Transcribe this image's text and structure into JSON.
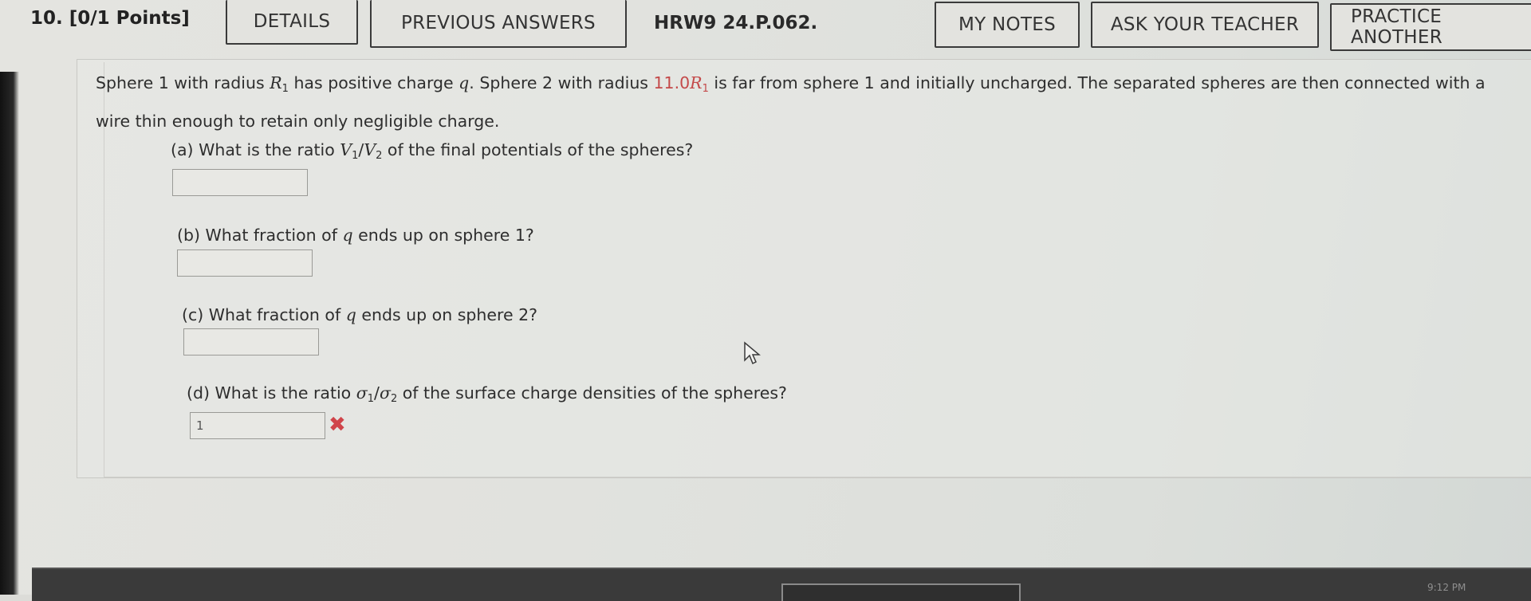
{
  "header": {
    "question_number": "10.",
    "points": "[0/1 Points]",
    "details_label": "DETAILS",
    "previous_answers_label": "PREVIOUS ANSWERS",
    "assignment_id": "HRW9 24.P.062.",
    "my_notes_label": "MY NOTES",
    "ask_teacher_label": "ASK YOUR TEACHER",
    "practice_label": "PRACTICE ANOTHER"
  },
  "problem": {
    "stem_a": "Sphere 1 with radius ",
    "r": "R",
    "one": "1",
    "stem_b": " has positive charge ",
    "q": "q",
    "stem_c": ". Sphere 2 with radius ",
    "radius_value": "11.0",
    "stem_d": " is far from sphere 1 and initially uncharged. The separated spheres are then connected with a wire thin enough to retain only negligible charge."
  },
  "parts": {
    "a": {
      "prefix": "(a) What is the ratio ",
      "v": "V",
      "one": "1",
      "slash": "/",
      "two": "2",
      "suffix": " of the final potentials of the spheres?",
      "answer": ""
    },
    "b": {
      "prefix": "(b) What fraction of ",
      "q": "q",
      "suffix": " ends up on sphere 1?",
      "answer": ""
    },
    "c": {
      "prefix": "(c) What fraction of ",
      "q": "q",
      "suffix": " ends up on sphere 2?",
      "answer": ""
    },
    "d": {
      "prefix": "(d) What is the ratio ",
      "sigma": "σ",
      "one": "1",
      "slash": "/",
      "two": "2",
      "suffix": " of the surface charge densities of the spheres?",
      "answer": "1",
      "status_icon": "incorrect-x-icon"
    }
  },
  "taskbar": {
    "time": "9:12 PM"
  },
  "colors": {
    "accent_red": "#c44a4a",
    "incorrect": "#d0444a"
  }
}
